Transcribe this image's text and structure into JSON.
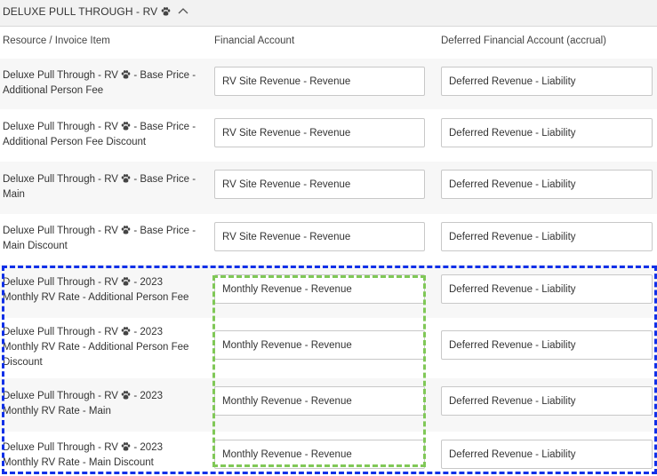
{
  "group": {
    "title": "DELUXE PULL THROUGH - RV",
    "paw_icon": "paw-icon",
    "chevron_icon": "chevron-up-icon"
  },
  "columns": {
    "resource": "Resource / Invoice Item",
    "financial": "Financial Account",
    "deferred": "Deferred Financial Account (accrual)"
  },
  "rows": [
    {
      "pre": "Deluxe Pull Through - RV",
      "line1_rest": " - Base Price -",
      "line2": "Additional Person Fee",
      "line3": "",
      "financial": "RV Site Revenue - Revenue",
      "deferred": "Deferred Revenue - Liability"
    },
    {
      "pre": "Deluxe Pull Through - RV",
      "line1_rest": " - Base Price -",
      "line2": "Additional Person Fee Discount",
      "line3": "",
      "financial": "RV Site Revenue - Revenue",
      "deferred": "Deferred Revenue - Liability"
    },
    {
      "pre": "Deluxe Pull Through - RV",
      "line1_rest": " - Base Price -",
      "line2": "Main",
      "line3": "",
      "financial": "RV Site Revenue - Revenue",
      "deferred": "Deferred Revenue - Liability"
    },
    {
      "pre": "Deluxe Pull Through - RV",
      "line1_rest": " - Base Price -",
      "line2": "Main Discount",
      "line3": "",
      "financial": "RV Site Revenue - Revenue",
      "deferred": "Deferred Revenue - Liability"
    },
    {
      "pre": "Deluxe Pull Through - RV",
      "line1_rest": " - 2023",
      "line2": "Monthly RV Rate - Additional Person Fee",
      "line3": "",
      "financial": "Monthly Revenue - Revenue",
      "deferred": "Deferred Revenue - Liability"
    },
    {
      "pre": "Deluxe Pull Through - RV",
      "line1_rest": " - 2023",
      "line2": "Monthly RV Rate - Additional Person Fee",
      "line3": "Discount",
      "financial": "Monthly Revenue - Revenue",
      "deferred": "Deferred Revenue - Liability"
    },
    {
      "pre": "Deluxe Pull Through - RV",
      "line1_rest": " - 2023",
      "line2": "Monthly RV Rate - Main",
      "line3": "",
      "financial": "Monthly Revenue - Revenue",
      "deferred": "Deferred Revenue - Liability"
    },
    {
      "pre": "Deluxe Pull Through - RV",
      "line1_rest": " - 2023",
      "line2": "Monthly RV Rate - Main Discount",
      "line3": "",
      "financial": "Monthly Revenue - Revenue",
      "deferred": "Deferred Revenue - Liability"
    }
  ],
  "highlights": {
    "rows_box_color": "#1030e8",
    "financial_box_color": "#80c857"
  }
}
